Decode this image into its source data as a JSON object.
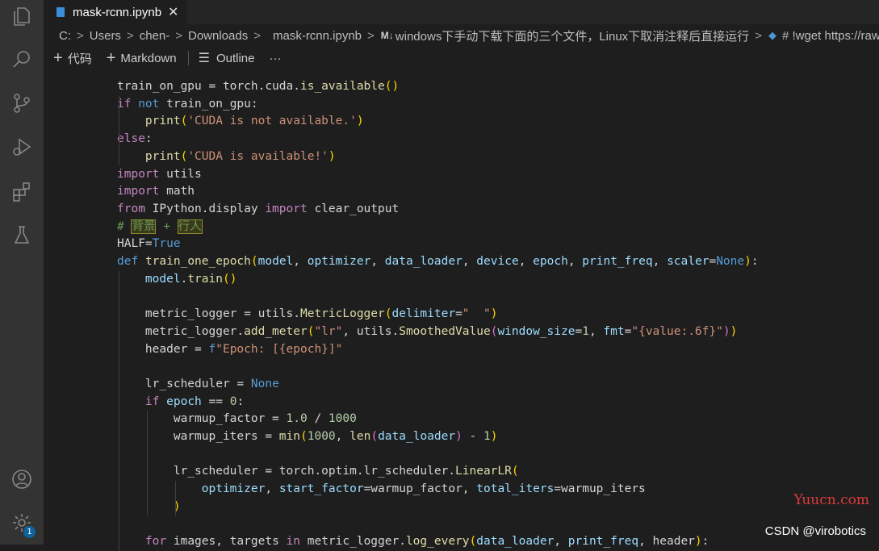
{
  "tab": {
    "file_name": "mask-rcnn.ipynb",
    "close_glyph": "✕"
  },
  "breadcrumb": {
    "items": [
      "C:",
      "Users",
      "chen-",
      "Downloads",
      "mask-rcnn.ipynb",
      "windows下手动下载下面的三个文件，Linux下取消注释后直接运行",
      "# !wget https://raw.gi"
    ],
    "separator": ">",
    "md_badge": "M↓"
  },
  "toolbar": {
    "add_code": "代码",
    "add_markdown": "Markdown",
    "outline": "Outline",
    "more": "···"
  },
  "activity_bar": {
    "icons": [
      "explorer-icon",
      "search-icon",
      "source-control-icon",
      "run-debug-icon",
      "extensions-icon",
      "testing-icon",
      "account-icon",
      "settings-gear-icon"
    ],
    "settings_badge": "1"
  },
  "code_lines": [
    "train_on_gpu = torch.cuda.is_available()",
    "if not train_on_gpu:",
    "    print('CUDA is not available.')",
    "else:",
    "    print('CUDA is available!')",
    "import utils",
    "import math",
    "from IPython.display import clear_output",
    "# 背景 + 行人",
    "HALF=True",
    "def train_one_epoch(model, optimizer, data_loader, device, epoch, print_freq, scaler=None):",
    "    model.train()",
    "",
    "    metric_logger = utils.MetricLogger(delimiter=\"  \")",
    "    metric_logger.add_meter(\"lr\", utils.SmoothedValue(window_size=1, fmt=\"{value:.6f}\"))",
    "    header = f\"Epoch: [{epoch}]\"",
    "",
    "    lr_scheduler = None",
    "    if epoch == 0:",
    "        warmup_factor = 1.0 / 1000",
    "        warmup_iters = min(1000, len(data_loader) - 1)",
    "",
    "        lr_scheduler = torch.optim.lr_scheduler.LinearLR(",
    "            optimizer, start_factor=warmup_factor, total_iters=warmup_iters",
    "        )",
    "",
    "    for images, targets in metric_logger.log_every(data_loader, print_freq, header):"
  ],
  "watermarks": {
    "site": "Yuucn.com",
    "author": "CSDN @virobotics"
  }
}
